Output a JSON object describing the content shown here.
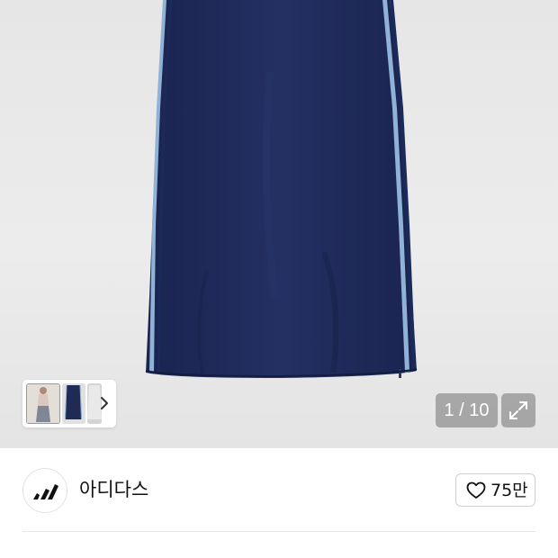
{
  "gallery": {
    "current": "1",
    "total": "10",
    "counter_text": "1 / 10",
    "colors": {
      "skirt": "#1f2a55",
      "stripe_light": "#8fb2d6",
      "background": "#e8e8e8"
    },
    "thumbnails": [
      {
        "name": "thumbnail-model-photo"
      },
      {
        "name": "thumbnail-front-view"
      },
      {
        "name": "thumbnail-back-view"
      }
    ]
  },
  "brand": {
    "name": "아디다스",
    "logo": "adidas-logo-icon"
  },
  "like": {
    "count": "75만",
    "icon": "heart-outline-icon"
  }
}
